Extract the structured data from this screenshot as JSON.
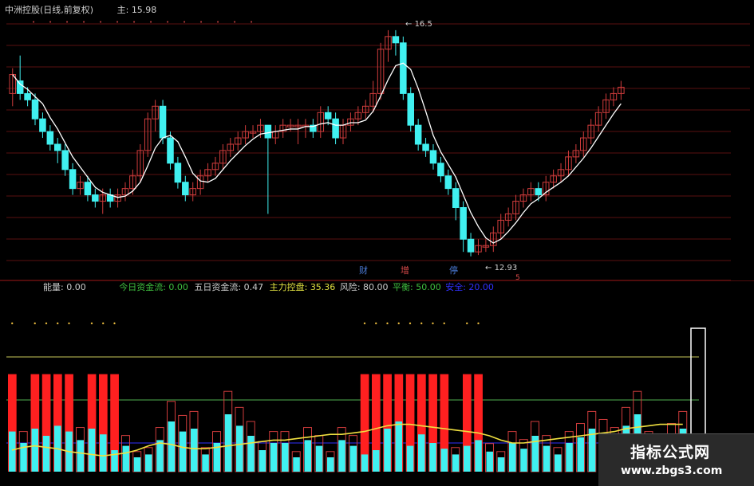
{
  "header": {
    "title": "中洲控股(日线,前复权)",
    "main_label": "主:",
    "main_value": "15.98"
  },
  "price_panel": {
    "high_marker": "16.5",
    "low_marker": "12.93",
    "events": [
      {
        "text": "财",
        "color": "#4a7bd8"
      },
      {
        "text": "增",
        "color": "#d84a4a"
      },
      {
        "text": "停",
        "color": "#4a7bd8"
      }
    ],
    "small_mark": "5"
  },
  "indicator_header": {
    "items": [
      {
        "label": "能量",
        "value": "0.00",
        "color": "#cccccc"
      },
      {
        "label": "今日资金流",
        "value": "0.00",
        "color": "#3fbf3f"
      },
      {
        "label": "五日资金流",
        "value": "0.47",
        "color": "#cccccc"
      },
      {
        "label": "主力控盘",
        "value": "35.36",
        "color": "#e0e040"
      },
      {
        "label": "风险",
        "value": "80.00",
        "color": "#cccccc"
      },
      {
        "label": "平衡",
        "value": "50.00",
        "color": "#3fbf3f"
      },
      {
        "label": "安全",
        "value": "20.00",
        "color": "#3030ff"
      }
    ]
  },
  "watermark": {
    "title": "指标公式网",
    "url": "www.zbgs3.com"
  },
  "colors": {
    "up": "#d03c3c",
    "down": "#40f0f0",
    "ma": "#ffffff",
    "risk_line": "#c8c85a",
    "balance_line": "#50b050",
    "safe_line": "#3030ff",
    "signal": "#ff2020",
    "control": "#f0e040"
  },
  "chart_data": [
    {
      "type": "candlestick",
      "name": "price",
      "candles": [
        [
          15.5,
          15.8,
          15.3,
          15.9
        ],
        [
          15.7,
          15.5,
          15.4,
          16.1
        ],
        [
          15.5,
          15.4,
          15.3,
          15.6
        ],
        [
          15.4,
          15.1,
          15.0,
          15.5
        ],
        [
          15.1,
          14.9,
          14.8,
          15.2
        ],
        [
          14.9,
          14.7,
          14.6,
          15.0
        ],
        [
          14.7,
          14.6,
          14.4,
          14.8
        ],
        [
          14.6,
          14.3,
          14.2,
          14.7
        ],
        [
          14.3,
          14.0,
          13.9,
          14.4
        ],
        [
          14.0,
          14.1,
          13.9,
          14.2
        ],
        [
          14.1,
          13.9,
          13.8,
          14.2
        ],
        [
          13.9,
          13.8,
          13.7,
          14.0
        ],
        [
          13.8,
          13.9,
          13.6,
          14.0
        ],
        [
          13.9,
          13.8,
          13.7,
          14.0
        ],
        [
          13.8,
          13.9,
          13.7,
          14.0
        ],
        [
          13.9,
          14.0,
          13.8,
          14.1
        ],
        [
          14.0,
          14.2,
          13.9,
          14.3
        ],
        [
          14.2,
          14.6,
          14.1,
          14.7
        ],
        [
          14.6,
          15.1,
          14.5,
          15.2
        ],
        [
          15.1,
          15.3,
          14.9,
          15.4
        ],
        [
          15.3,
          14.8,
          14.7,
          15.4
        ],
        [
          14.8,
          14.4,
          14.3,
          14.9
        ],
        [
          14.4,
          14.1,
          14.0,
          14.5
        ],
        [
          14.1,
          13.9,
          13.8,
          14.2
        ],
        [
          13.9,
          14.0,
          13.8,
          14.1
        ],
        [
          14.0,
          14.2,
          13.9,
          14.3
        ],
        [
          14.2,
          14.3,
          14.1,
          14.4
        ],
        [
          14.3,
          14.4,
          14.2,
          14.5
        ],
        [
          14.4,
          14.6,
          14.3,
          14.7
        ],
        [
          14.6,
          14.7,
          14.5,
          14.8
        ],
        [
          14.7,
          14.8,
          14.6,
          14.9
        ],
        [
          14.8,
          14.9,
          14.7,
          15.0
        ],
        [
          14.9,
          14.9,
          14.8,
          15.0
        ],
        [
          14.9,
          15.0,
          14.8,
          15.1
        ],
        [
          15.0,
          14.8,
          13.6,
          15.0
        ],
        [
          14.8,
          14.9,
          14.7,
          15.0
        ],
        [
          14.9,
          15.0,
          14.8,
          15.1
        ],
        [
          15.0,
          15.0,
          14.9,
          15.1
        ],
        [
          15.0,
          15.0,
          14.7,
          15.1
        ],
        [
          15.0,
          15.0,
          14.8,
          15.1
        ],
        [
          15.0,
          14.9,
          14.8,
          15.1
        ],
        [
          14.9,
          15.2,
          14.8,
          15.3
        ],
        [
          15.2,
          15.1,
          15.0,
          15.3
        ],
        [
          15.1,
          14.8,
          14.7,
          15.2
        ],
        [
          14.8,
          15.0,
          14.7,
          15.1
        ],
        [
          15.0,
          15.1,
          14.9,
          15.2
        ],
        [
          15.1,
          15.2,
          15.0,
          15.3
        ],
        [
          15.2,
          15.3,
          15.1,
          15.4
        ],
        [
          15.3,
          15.5,
          15.2,
          15.7
        ],
        [
          15.5,
          16.2,
          15.4,
          16.3
        ],
        [
          16.2,
          16.4,
          16.0,
          16.5
        ],
        [
          16.4,
          16.3,
          16.1,
          16.5
        ],
        [
          16.3,
          15.5,
          15.4,
          16.4
        ],
        [
          15.5,
          15.0,
          14.9,
          15.6
        ],
        [
          15.0,
          14.7,
          14.6,
          15.1
        ],
        [
          14.7,
          14.6,
          14.5,
          14.8
        ],
        [
          14.6,
          14.4,
          14.3,
          14.7
        ],
        [
          14.4,
          14.2,
          14.1,
          14.5
        ],
        [
          14.2,
          14.0,
          13.9,
          14.3
        ],
        [
          14.0,
          13.7,
          13.5,
          14.1
        ],
        [
          13.7,
          13.2,
          13.0,
          13.8
        ],
        [
          13.2,
          13.0,
          12.93,
          13.3
        ],
        [
          13.0,
          13.1,
          12.95,
          13.2
        ],
        [
          13.1,
          13.1,
          13.0,
          13.2
        ],
        [
          13.1,
          13.3,
          13.0,
          13.4
        ],
        [
          13.3,
          13.5,
          13.2,
          13.6
        ],
        [
          13.5,
          13.6,
          13.4,
          13.7
        ],
        [
          13.6,
          13.8,
          13.5,
          13.9
        ],
        [
          13.8,
          13.9,
          13.7,
          14.0
        ],
        [
          13.9,
          14.0,
          13.8,
          14.1
        ],
        [
          14.0,
          13.9,
          13.8,
          14.1
        ],
        [
          13.9,
          14.1,
          13.8,
          14.2
        ],
        [
          14.1,
          14.2,
          14.0,
          14.3
        ],
        [
          14.2,
          14.3,
          14.1,
          14.4
        ],
        [
          14.3,
          14.5,
          14.2,
          14.6
        ],
        [
          14.5,
          14.6,
          14.4,
          14.7
        ],
        [
          14.6,
          14.8,
          14.5,
          14.9
        ],
        [
          14.8,
          15.0,
          14.7,
          15.1
        ],
        [
          15.0,
          15.2,
          14.9,
          15.3
        ],
        [
          15.2,
          15.4,
          15.1,
          15.5
        ],
        [
          15.4,
          15.5,
          15.3,
          15.6
        ],
        [
          15.5,
          15.6,
          15.4,
          15.7
        ]
      ],
      "ylim": [
        12.7,
        16.7
      ]
    },
    {
      "type": "bar",
      "name": "indicator",
      "ylim": [
        0,
        100
      ],
      "levels": {
        "risk": 80,
        "balance": 50,
        "safe": 20
      },
      "signal_bars": [
        0,
        2,
        3,
        4,
        5,
        7,
        8,
        9,
        31,
        32,
        33,
        34,
        35,
        36,
        37,
        38,
        40,
        41
      ],
      "values": [
        28,
        20,
        30,
        25,
        32,
        28,
        22,
        30,
        26,
        15,
        18,
        10,
        12,
        22,
        35,
        28,
        30,
        12,
        20,
        40,
        32,
        25,
        15,
        20,
        20,
        10,
        22,
        18,
        10,
        22,
        18,
        12,
        15,
        30,
        35,
        18,
        26,
        20,
        16,
        12,
        18,
        22,
        14,
        10,
        20,
        16,
        25,
        18,
        12,
        20,
        24,
        30,
        26,
        22,
        32,
        40,
        20,
        18,
        24,
        30
      ],
      "control": [
        15,
        17,
        18,
        17,
        16,
        14,
        13,
        12,
        11,
        12,
        13,
        15,
        18,
        20,
        19,
        17,
        16,
        16,
        17,
        18,
        19,
        20,
        21,
        22,
        22,
        23,
        24,
        25,
        26,
        26,
        27,
        28,
        30,
        32,
        33,
        33,
        32,
        31,
        30,
        29,
        28,
        27,
        25,
        22,
        20,
        20,
        21,
        22,
        23,
        24,
        25,
        26,
        27,
        28,
        30,
        31,
        32,
        33,
        33,
        33
      ],
      "last_box": 100
    }
  ]
}
